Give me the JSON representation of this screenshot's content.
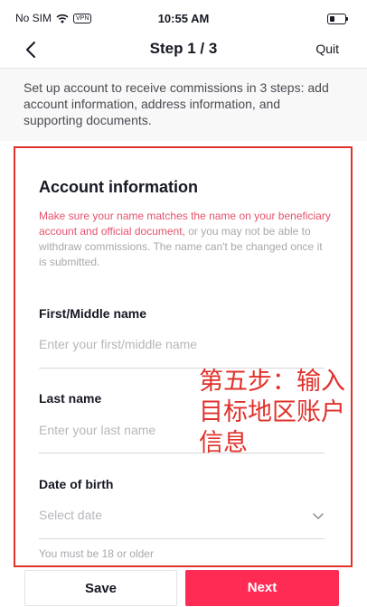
{
  "status_bar": {
    "carrier": "No SIM",
    "vpn": "VPN",
    "time": "10:55 AM"
  },
  "header": {
    "title": "Step 1 / 3",
    "quit_label": "Quit"
  },
  "intro": {
    "text": "Set up account to receive commissions in 3 steps: add account information, address information, and supporting documents."
  },
  "form": {
    "title": "Account information",
    "hint_highlight": "Make sure your name matches the name on your beneficiary account and official document,",
    "hint_rest": " or you may not be able to withdraw commissions. The name can't be changed once it is submitted.",
    "fields": [
      {
        "label": "First/Middle name",
        "placeholder": "Enter your first/middle name"
      },
      {
        "label": "Last name",
        "placeholder": "Enter your last name"
      },
      {
        "label": "Date of birth",
        "placeholder": "Select date"
      }
    ],
    "age_note": "You must be 18 or older"
  },
  "annotation": "第五步：输入目标地区账户信息",
  "footer": {
    "save_label": "Save",
    "next_label": "Next"
  },
  "colors": {
    "accent": "#fe2c55",
    "annotation": "#e0312b",
    "hint_error": "#e5526b"
  },
  "icons": [
    "wifi-icon",
    "battery-icon",
    "back-arrow-icon",
    "chevron-down-icon"
  ]
}
